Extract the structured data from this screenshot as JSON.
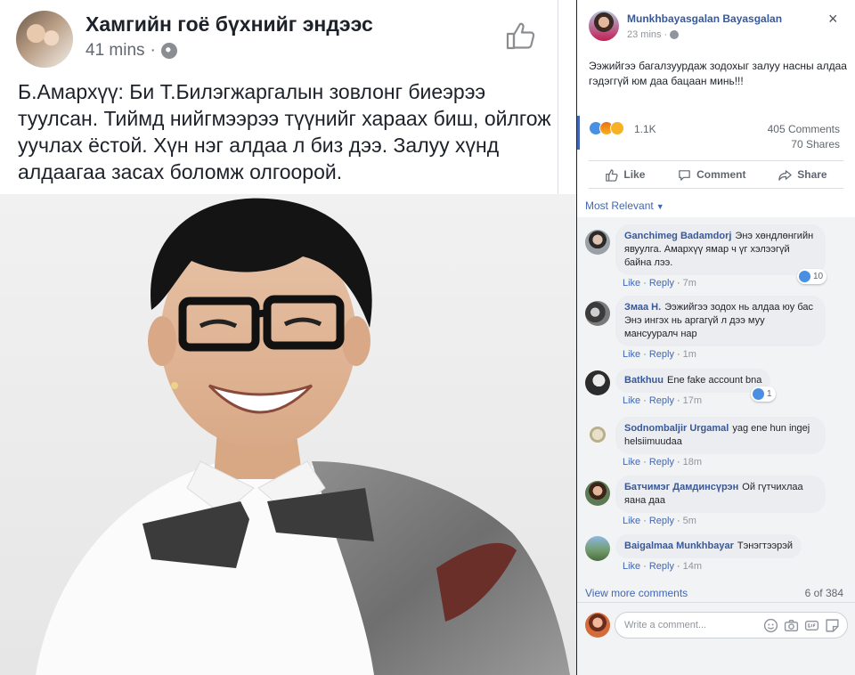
{
  "post": {
    "page_name": "Хамгийн гоё бүхнийг эндээс",
    "time": "41 mins",
    "separator": "·",
    "text": "Б.Амархүү: Би Т.Билэгжаргалын зовлонг биеэрээ туулсан. Тиймд нийгмээрээ түүнийг хараах биш, ойлгож уучлах ёстой. Хүн нэг алдаа л биз дээ. Залуу хүнд алдаагаа засах боломж олгоорой."
  },
  "fb_post": {
    "author": "Munkhbayasgalan Bayasgalan",
    "time": "23 mins",
    "close_glyph": "×",
    "text": "Ээжийгээ багалзуурдаж зодохыг залуу насны алдаа гэдэггүй юм даа бацаан минь!!!",
    "reaction_count": "1.1K",
    "comments_count": "405 Comments",
    "shares_count": "70 Shares",
    "actions": {
      "like": "Like",
      "comment": "Comment",
      "share": "Share"
    }
  },
  "sort_label": "Most Relevant",
  "comment_actions": {
    "like": "Like",
    "reply": "Reply",
    "dot": "·"
  },
  "comments": [
    {
      "name": "Ganchimeg Badamdorj",
      "text": "Энэ хөндлөнгийн явуулга. Амархүү ямар ч үг хэлээгүй байна лээ.",
      "time": "7m",
      "likes": "10"
    },
    {
      "name": "Змаа Н.",
      "text": "Ээжийгээ зодох нь алдаа юу бас Энэ ингэх нь аргагүй л дээ муу мансууралч нар",
      "time": "1m",
      "likes": ""
    },
    {
      "name": "Batkhuu",
      "text": "Ene fake account bna",
      "time": "17m",
      "likes": "1"
    },
    {
      "name": "Sodnombaljir Urgamal",
      "text": "yag ene hun ingej helsiimuudaa",
      "time": "18m",
      "likes": ""
    },
    {
      "name": "Батчимэг Дамдинсүрэн",
      "text": "Ой гүтчихлаа яана даа",
      "time": "5m",
      "likes": ""
    },
    {
      "name": "Baigalmaa Munkhbayar",
      "text": "Тэнэгтээрэй",
      "time": "14m",
      "likes": ""
    }
  ],
  "view_more": "View more comments",
  "pager": "6 of 384",
  "composer_placeholder": "Write a comment...",
  "icons": [
    "globe-icon",
    "thumbs-up-icon",
    "close-icon",
    "like-icon",
    "comment-icon",
    "share-icon",
    "emoji-icon",
    "camera-icon",
    "gif-icon",
    "sticker-icon"
  ],
  "colors": {
    "link": "#385898",
    "accent": "#4267b2",
    "comment_bg": "#f2f3f5",
    "bubble": "#ebedf0"
  }
}
